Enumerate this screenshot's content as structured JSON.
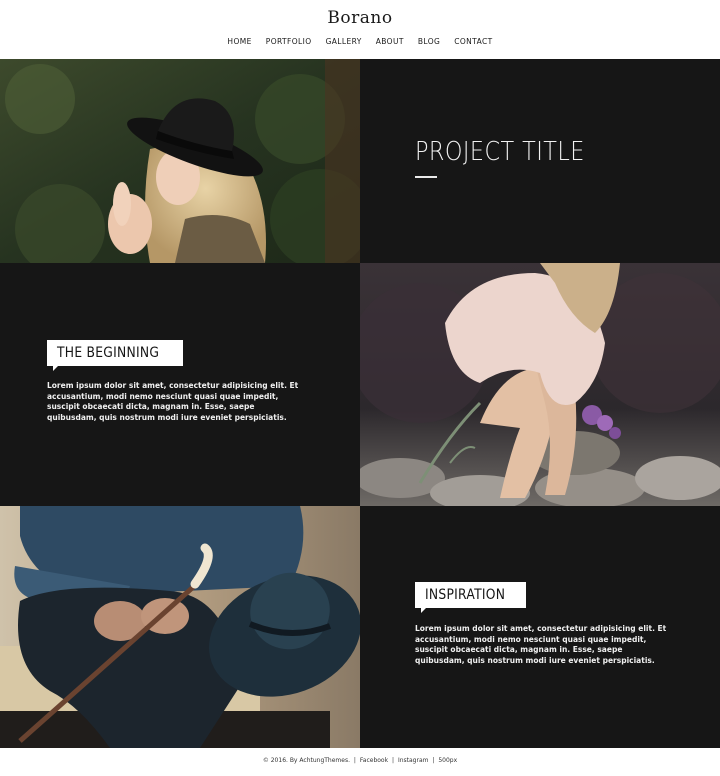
{
  "header": {
    "brand": "Borano",
    "nav": [
      "HOME",
      "PORTFOLIO",
      "GALLERY",
      "ABOUT",
      "BLOG",
      "CONTACT"
    ]
  },
  "project": {
    "title": "PROJECT TITLE"
  },
  "sections": [
    {
      "heading": "THE BEGINNING",
      "text": "Lorem ipsum dolor sit amet, consectetur adipisicing elit. Et accusantium, modi nemo nesciunt quasi quae impedit, suscipit obcaecati dicta, magnam in. Esse, saepe quibusdam, quis nostrum modi iure eveniet perspiciatis."
    },
    {
      "heading": "INSPIRATION",
      "text": "Lorem ipsum dolor sit amet, consectetur adipisicing elit. Et accusantium, modi nemo nesciunt quasi quae impedit, suscipit obcaecati dicta, magnam in. Esse, saepe quibusdam, quis nostrum modi iure eveniet perspiciatis."
    }
  ],
  "footer": {
    "copyright": "© 2016. By AchtungThemes.",
    "sep1": "|",
    "facebook": "Facebook",
    "sep2": "|",
    "instagram": "Instagram",
    "sep3": "|",
    "px500": "500px"
  },
  "colors": {
    "dark_panel": "#161616",
    "text_light": "#f2f2f2",
    "page_bg": "#ffffff"
  }
}
